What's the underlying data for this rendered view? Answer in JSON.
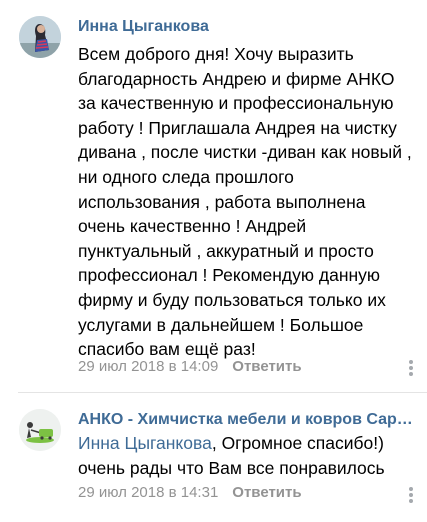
{
  "comments": [
    {
      "author": "Инна Цыганкова",
      "text": "Всем доброго дня! Хочу выразить благодарность Андрею и фирме АНКО за качественную и профессиональную работу ! Приглашала Андрея на чистку дивана , после чистки -диван как новый , ни одного следа прошлого использования , работа выполнена очень качественно ! Андрей пунктуальный , аккуратный и просто профессионал ! Рекомендую данную фирму и буду пользоваться только их услугами в дальнейшем ! Большое спасибо вам ещё раз!",
      "date": "29 июл 2018 в 14:09",
      "reply_label": "Ответить"
    },
    {
      "author": "АНКО - Химчистка мебели и ковров Сар…",
      "reply_to": "Инна Цыганкова",
      "text": ", Огромное спасибо!) очень рады что Вам все понравилось",
      "date": "29 июл 2018 в 14:31",
      "reply_label": "Ответить"
    }
  ]
}
